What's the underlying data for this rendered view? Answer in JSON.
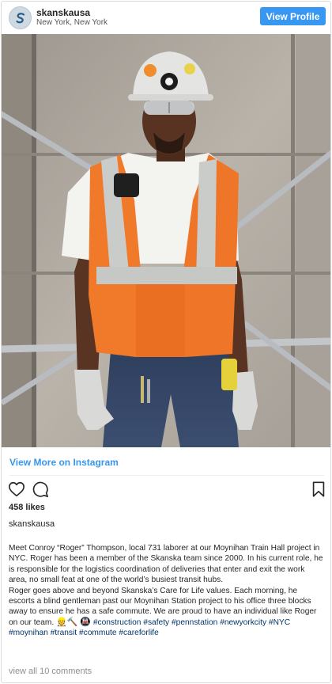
{
  "header": {
    "username": "skanskausa",
    "location": "New York, New York",
    "view_profile_label": "View Profile"
  },
  "post": {
    "view_more_label": "View More on Instagram",
    "likes": "458 likes",
    "caption_username": "skanskausa",
    "caption_paragraph_1": "Meet Conroy “Roger” Thompson, local 731 laborer at our Moynihan Train Hall project in NYC. Roger has been a member of the Skanska team since 2000. In his current role, he is responsible for the logistics coordination of deliveries that enter and exit the work area, no small feat at one of the world’s busiest transit hubs.",
    "caption_paragraph_2": "Roger goes above and beyond Skanska’s Care for Life values. Each morning, he escorts a blind gentleman past our Moynihan Station project to his office three blocks away to ensure he has a safe commute. We are proud to have an individual like Roger on our team.",
    "caption_emojis": [
      "👷",
      "🔨",
      "🚇"
    ],
    "hashtags": [
      "#construction",
      "#safety",
      "#pennstation",
      "#newyorkcity",
      "#NYC",
      "#moynihan",
      "#transit",
      "#commute",
      "#careforlife"
    ],
    "view_comments_label": "view all 10 comments"
  },
  "icons": {
    "like": "heart-outline-icon",
    "comment": "speech-bubble-icon",
    "save": "bookmark-outline-icon",
    "avatar": "skanska-logo"
  },
  "colors": {
    "accent": "#3897f0",
    "hashtag": "#003569",
    "vest": "#f07a2a"
  }
}
